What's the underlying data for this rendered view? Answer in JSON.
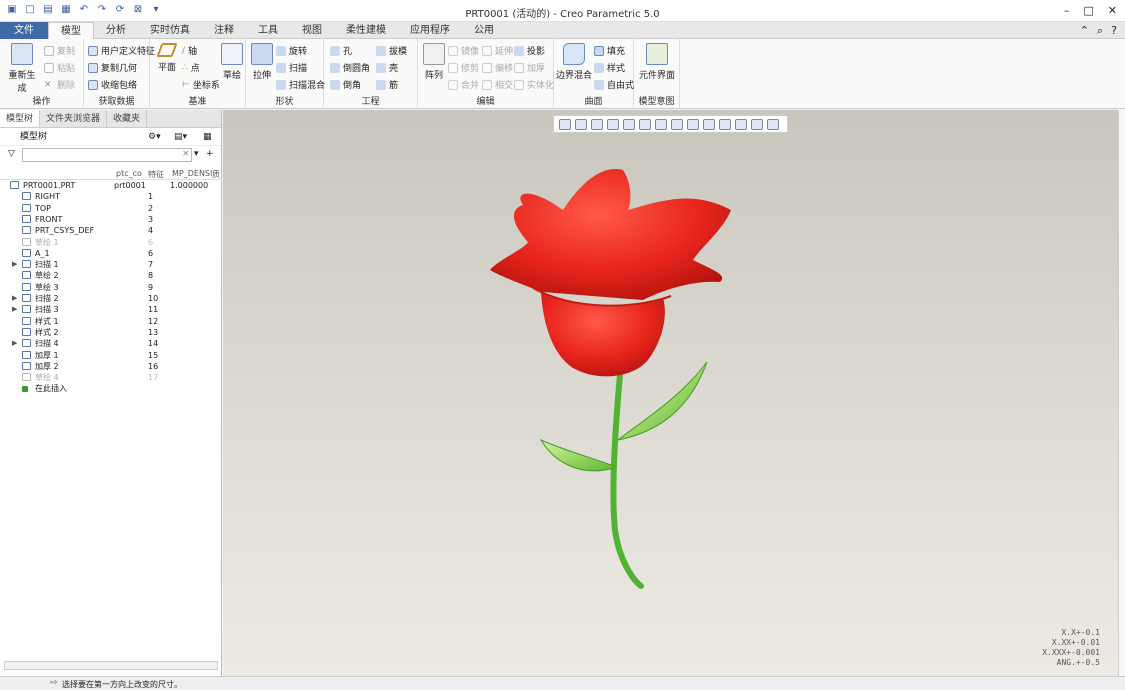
{
  "window": {
    "title": "PRT0001 (活动的) - Creo Parametric 5.0"
  },
  "tabs": [
    "文件",
    "模型",
    "分析",
    "实时仿真",
    "注释",
    "工具",
    "视图",
    "柔性建模",
    "应用程序",
    "公用"
  ],
  "ribbon": {
    "operations": {
      "label": "操作",
      "regen": "重新生成",
      "copy": "复制",
      "paste": "粘贴",
      "delete": "删除"
    },
    "getdata": {
      "label": "获取数据",
      "udf": "用户定义特征",
      "copygeom": "复制几何",
      "shrinkwrap": "收缩包络"
    },
    "datum": {
      "label": "基准",
      "plane": "平面",
      "axis": "轴",
      "point": "点",
      "csys": "坐标系",
      "sketch": "草绘"
    },
    "shapes": {
      "label": "形状",
      "extrude": "拉伸",
      "revolve": "旋转",
      "sweep": "扫描",
      "sweptblend": "扫描混合"
    },
    "engineering": {
      "label": "工程",
      "hole": "孔",
      "draft": "拔模",
      "round": "倒圆角",
      "shell": "壳",
      "chamfer": "倒角",
      "rib": "筋"
    },
    "editing": {
      "label": "编辑",
      "pattern": "阵列",
      "mirror": "镜像",
      "extend": "延伸",
      "project": "投影",
      "trim": "修剪",
      "offset": "偏移",
      "thicken": "加厚",
      "merge": "合并",
      "intersect": "相交",
      "solidify": "实体化"
    },
    "surfaces": {
      "label": "曲面",
      "boundary": "边界混合",
      "fill": "填充",
      "style": "样式",
      "freestyle": "自由式"
    },
    "modelintent": {
      "label": "模型意图",
      "component": "元件界面"
    }
  },
  "panel": {
    "tabs": [
      "模型树",
      "文件夹浏览器",
      "收藏夹"
    ],
    "header": "模型树",
    "columns": [
      "ptc_co",
      "特征",
      "MP_DENSI",
      "质"
    ],
    "rows": [
      {
        "name": "PRT0001.PRT",
        "c2": "prt0001",
        "c3": "1.000000",
        "indent": 1,
        "arrow": ""
      },
      {
        "name": "RIGHT",
        "c2": "1",
        "c3": "",
        "indent": 2,
        "arrow": ""
      },
      {
        "name": "TOP",
        "c2": "2",
        "c3": "",
        "indent": 2,
        "arrow": ""
      },
      {
        "name": "FRONT",
        "c2": "3",
        "c3": "",
        "indent": 2,
        "arrow": ""
      },
      {
        "name": "PRT_CSYS_DEF",
        "c2": "4",
        "c3": "",
        "indent": 2,
        "arrow": ""
      },
      {
        "name": "草绘 1",
        "c2": "6",
        "c3": "",
        "indent": 2,
        "arrow": "",
        "dim": true
      },
      {
        "name": "A_1",
        "c2": "6",
        "c3": "",
        "indent": 2,
        "arrow": ""
      },
      {
        "name": "扫描 1",
        "c2": "7",
        "c3": "",
        "indent": 2,
        "arrow": "▶"
      },
      {
        "name": "草绘 2",
        "c2": "8",
        "c3": "",
        "indent": 2,
        "arrow": ""
      },
      {
        "name": "草绘 3",
        "c2": "9",
        "c3": "",
        "indent": 2,
        "arrow": ""
      },
      {
        "name": "扫描 2",
        "c2": "10",
        "c3": "",
        "indent": 2,
        "arrow": "▶"
      },
      {
        "name": "扫描 3",
        "c2": "11",
        "c3": "",
        "indent": 2,
        "arrow": "▶"
      },
      {
        "name": "样式 1",
        "c2": "12",
        "c3": "",
        "indent": 2,
        "arrow": ""
      },
      {
        "name": "样式 2",
        "c2": "13",
        "c3": "",
        "indent": 2,
        "arrow": ""
      },
      {
        "name": "扫描 4",
        "c2": "14",
        "c3": "",
        "indent": 2,
        "arrow": "▶"
      },
      {
        "name": "加厚 1",
        "c2": "15",
        "c3": "",
        "indent": 2,
        "arrow": ""
      },
      {
        "name": "加厚 2",
        "c2": "16",
        "c3": "",
        "indent": 2,
        "arrow": ""
      },
      {
        "name": "草绘 4",
        "c2": "17",
        "c3": "",
        "indent": 2,
        "arrow": "",
        "dim": true
      },
      {
        "name": "在此插入",
        "c2": "",
        "c3": "",
        "indent": 2,
        "arrow": "",
        "insert": true
      }
    ]
  },
  "tolerances": [
    "X.X+-0.1",
    "X.XX+-0.01",
    "X.XXX+-0.001",
    "ANG.+-0.5"
  ],
  "status": "选择要在第一方向上改变的尺寸。",
  "colors": {
    "accent": "#3e6aa8",
    "petal": "#e8251d",
    "stem": "#4fb431",
    "leaf": "#8fd14f"
  }
}
